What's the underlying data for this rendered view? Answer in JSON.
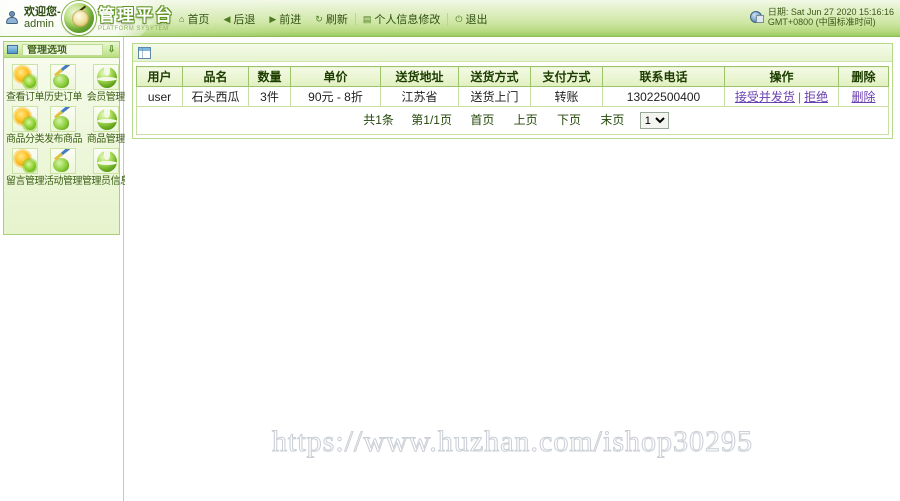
{
  "header": {
    "welcome_line1": "欢迎您-",
    "welcome_line2": "admin",
    "logo_cn": "管理平台",
    "logo_en": "PLATFORM SYSYTEM",
    "nav": [
      {
        "label": "首页",
        "icon": "home-icon",
        "glyph": "⌂"
      },
      {
        "label": "后退",
        "icon": "back-arrow-icon",
        "glyph": "◀"
      },
      {
        "label": "前进",
        "icon": "forward-arrow-icon",
        "glyph": "▶"
      },
      {
        "label": "刷新",
        "icon": "refresh-icon",
        "glyph": "↻"
      },
      {
        "label": "个人信息修改",
        "icon": "user-edit-icon",
        "glyph": "▤"
      },
      {
        "label": "退出",
        "icon": "power-off-icon",
        "glyph": "⏻"
      }
    ],
    "date_line1": "日期: Sat Jun 27 2020 15:16:16",
    "date_line2": "GMT+0800 (中国标准时间)",
    "date_icon": "globe-clock-icon"
  },
  "sidebar": {
    "panel_title": "管理选项",
    "panel_icon": "window-icon",
    "collapse_icon": "arrow-down-icon",
    "items": [
      {
        "label": "查看订单",
        "icon": "gears-icon",
        "style": "gears"
      },
      {
        "label": "历史订单",
        "icon": "brush-icon",
        "style": "brush"
      },
      {
        "label": "会员管理",
        "icon": "green-orb-icon",
        "style": "orb"
      },
      {
        "label": "商品分类",
        "icon": "gears-icon",
        "style": "gears"
      },
      {
        "label": "发布商品",
        "icon": "brush-icon",
        "style": "brush"
      },
      {
        "label": "商品管理",
        "icon": "green-orb-icon",
        "style": "orb"
      },
      {
        "label": "留言管理",
        "icon": "gears-icon",
        "style": "gears"
      },
      {
        "label": "活动管理",
        "icon": "brush-icon",
        "style": "brush"
      },
      {
        "label": "管理员信息",
        "icon": "green-orb-icon",
        "style": "orb"
      }
    ]
  },
  "main": {
    "frame_icon": "table-grid-icon",
    "table": {
      "columns": [
        "用户",
        "品名",
        "数量",
        "单价",
        "送货地址",
        "送货方式",
        "支付方式",
        "联系电话",
        "操作",
        "删除"
      ],
      "rows": [
        {
          "user": "user",
          "product": "石头西瓜",
          "quantity": "3件",
          "price": "90元 - 8折",
          "address": "江苏省",
          "shipping": "送货上门",
          "payment": "转账",
          "phone": "13022500400",
          "action_accept": "接受并发货",
          "action_sep": "|",
          "action_reject": "拒绝",
          "delete": "删除"
        }
      ]
    },
    "pager": {
      "total": "共1条",
      "page_of": "第1/1页",
      "first": "首页",
      "prev": "上页",
      "next": "下页",
      "last": "末页",
      "selected_page": "1"
    }
  },
  "watermark": "https://www.huzhan.com/ishop30295"
}
